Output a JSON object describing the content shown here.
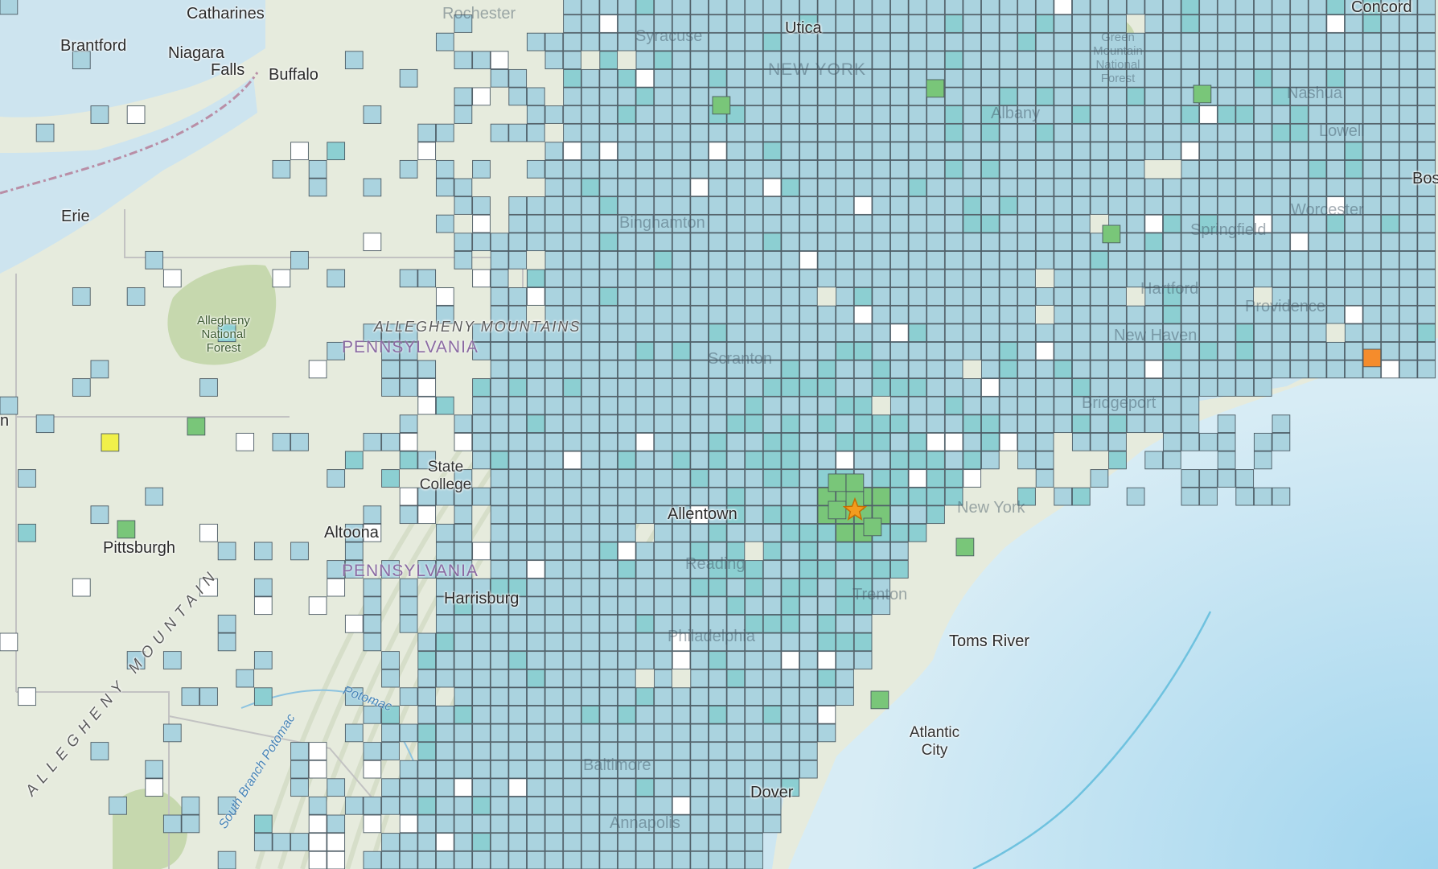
{
  "map": {
    "colors": {
      "land": "#e6ebdd",
      "land_forest": "#c8d9b1",
      "water": "#cfe6f2",
      "ocean_deep": "#a7d7ef",
      "lake": "#b9dcee",
      "state_border": "#bfbfbf",
      "intl_border": "#b48a9d",
      "cell_intensity_2": "#aad3df",
      "cell_intensity_3": "#8ccfd2",
      "cell_intensity_4": "#79c679",
      "cell_intensity_5": "#f0f04a",
      "cell_intensity_7": "#f58c2c",
      "cell_no_felt": "#ffffff",
      "cell_stroke": "#4b5a63",
      "epicenter_star": "#f39c1e"
    },
    "epicenter": {
      "icon": "star-icon"
    },
    "labels": {
      "catharines": "Catharines",
      "rochester": "Rochester",
      "utica": "Utica",
      "concord": "Concord",
      "brantford": "Brantford",
      "niagara": "Niagara",
      "falls": "Falls",
      "buffalo": "Buffalo",
      "syracuse": "Syracuse",
      "green_mountain": "Green Mountain National Forest",
      "ny": "NEW YORK",
      "albany": "Albany",
      "nashua": "Nashua",
      "lowell": "Lowell",
      "erie": "Erie",
      "binghamton": "Binghamton",
      "worcester": "Worcester",
      "boston": "Bos",
      "springfield": "Springfield",
      "allegheny_forest": "Allegheny National Forest",
      "allegheny_mountains": "ALLEGHENY MOUNTAINS",
      "pennsylvania_1": "PENNSYLVANIA",
      "hartford": "Hartford",
      "providence": "Providence",
      "scranton": "Scranton",
      "new_haven": "New Haven",
      "bridgeport": "Bridgeport",
      "state_college": "State College",
      "allentown": "Allentown",
      "new_york": "New York",
      "altoona": "Altoona",
      "pittsburgh": "Pittsburgh",
      "pennsylvania_2": "PENNSYLVANIA",
      "reading": "Reading",
      "trenton": "Trenton",
      "harrisburg": "Harrisburg",
      "toms_river": "Toms River",
      "philadelphia": "Philadelphia",
      "potomac": "Potomac",
      "south_branch_potomac": "South Branch Potomac",
      "atlantic_city": "Atlantic City",
      "baltimore": "Baltimore",
      "dover": "Dover",
      "annapolis": "Annapolis",
      "allegheny_mountain_sw": "ALLEGHENY MOUNTAIN",
      "left_edge": "n"
    }
  }
}
